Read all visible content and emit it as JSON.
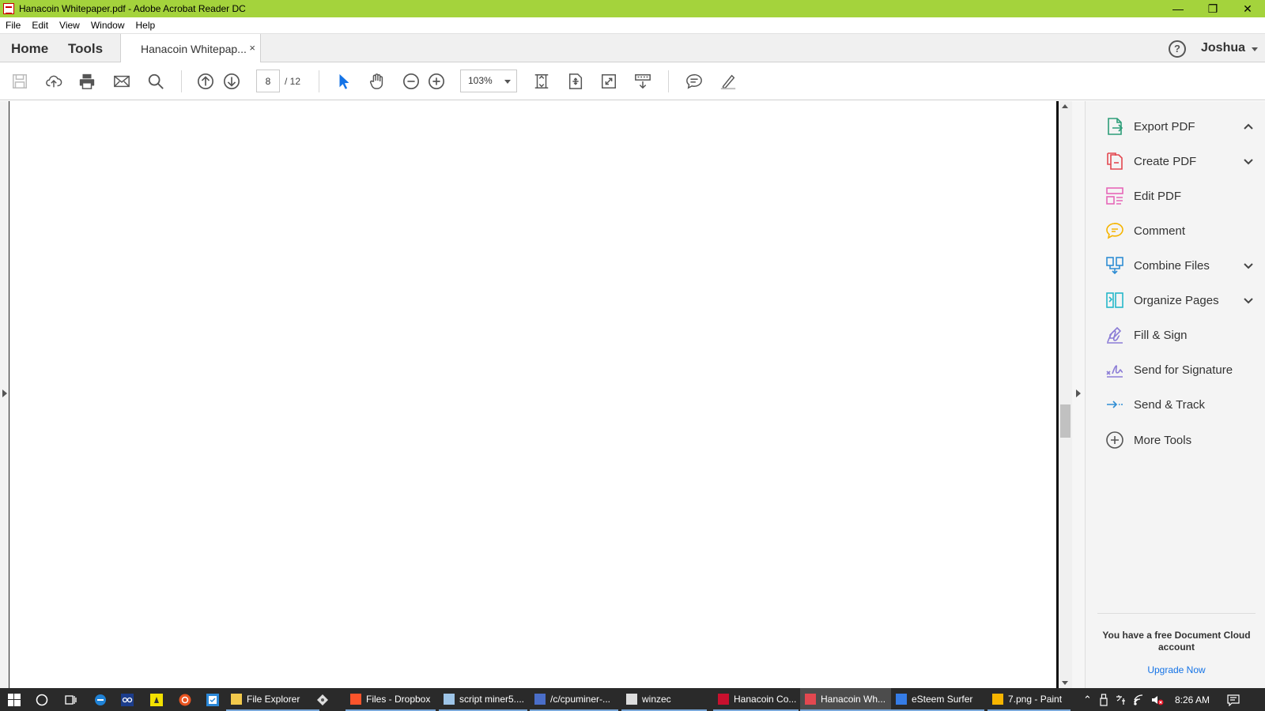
{
  "window": {
    "title": "Hanacoin Whitepaper.pdf - Adobe Acrobat Reader DC",
    "title_bar_color": "#a4d33c",
    "minimize": "—",
    "restore": "❐",
    "close": "✕"
  },
  "menu": [
    "File",
    "Edit",
    "View",
    "Window",
    "Help"
  ],
  "tabs": {
    "home": "Home",
    "tools": "Tools",
    "document": "Hanacoin Whitepap...",
    "close": "×",
    "help": "?",
    "user": "Joshua"
  },
  "toolbar": {
    "icons": [
      "save-icon",
      "upload-icon",
      "print-icon",
      "email-icon",
      "search-icon",
      "previous-page-icon",
      "next-page-icon",
      "select-cursor-icon",
      "hand-tool-icon",
      "zoom-out-icon",
      "zoom-in-icon",
      "fit-page-icon",
      "scrolling-mode-icon",
      "full-screen-icon",
      "read-mode-icon",
      "comment-icon",
      "highlight-icon"
    ],
    "page_current": "8",
    "page_total": "/ 12",
    "zoom": "103%"
  },
  "scroll": {
    "position_fraction": 0.55
  },
  "right_panel": {
    "items": [
      {
        "label": "Export PDF",
        "icon": "export-pdf-icon",
        "color": "#2d9d78",
        "chevron": "up"
      },
      {
        "label": "Create PDF",
        "icon": "create-pdf-icon",
        "color": "#e34850",
        "chevron": "down"
      },
      {
        "label": "Edit PDF",
        "icon": "edit-pdf-icon",
        "color": "#e667b8",
        "chevron": ""
      },
      {
        "label": "Comment",
        "icon": "comment-icon",
        "color": "#f5b400",
        "chevron": ""
      },
      {
        "label": "Combine Files",
        "icon": "combine-files-icon",
        "color": "#2f8dd3",
        "chevron": "down"
      },
      {
        "label": "Organize Pages",
        "icon": "organize-pages-icon",
        "color": "#26b7c9",
        "chevron": "down"
      },
      {
        "label": "Fill & Sign",
        "icon": "fill-sign-icon",
        "color": "#8b7cd6",
        "chevron": ""
      },
      {
        "label": "Send for Signature",
        "icon": "send-signature-icon",
        "color": "#8b7cd6",
        "chevron": ""
      },
      {
        "label": "Send & Track",
        "icon": "send-track-icon",
        "color": "#2f8dd3",
        "chevron": ""
      },
      {
        "label": "More Tools",
        "icon": "more-tools-icon",
        "color": "#555555",
        "chevron": ""
      }
    ],
    "promo": "You have a free Document Cloud account",
    "upgrade": "Upgrade Now"
  },
  "taskbar": {
    "items": [
      {
        "label": "File Explorer",
        "icon": "folder-icon",
        "color": "#f2c94c"
      },
      {
        "label": "Files - Dropbox",
        "icon": "brave-icon",
        "color": "#fb542b"
      },
      {
        "label": "script miner5....",
        "icon": "notepad-icon",
        "color": "#9ec5e8"
      },
      {
        "label": "/c/cpuminer-...",
        "icon": "msys-icon",
        "color": "#4a6ec9"
      },
      {
        "label": "winzec",
        "icon": "terminal-icon",
        "color": "#dddddd"
      },
      {
        "label": "Hanacoin Co...",
        "icon": "opera-icon",
        "color": "#c8102e"
      },
      {
        "label": "Hanacoin Wh...",
        "icon": "acrobat-icon",
        "color": "#e34850"
      },
      {
        "label": "eSteem Surfer",
        "icon": "esteem-icon",
        "color": "#357ce6"
      },
      {
        "label": "7.png - Paint",
        "icon": "paint-icon",
        "color": "#f7b500"
      }
    ],
    "time": "8:26 AM"
  }
}
